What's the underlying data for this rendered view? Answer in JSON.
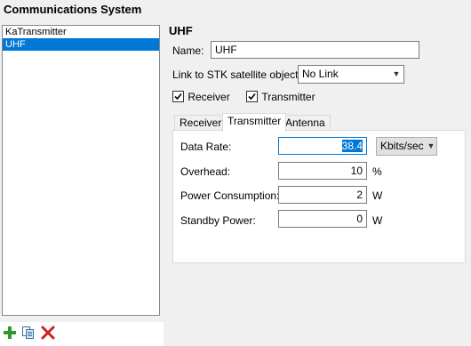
{
  "section_title": "Communications System",
  "systems": [
    {
      "label": "KaTransmitter",
      "selected": false
    },
    {
      "label": "UHF",
      "selected": true
    }
  ],
  "toolbar": {
    "add_icon": "plus-icon",
    "copy_icon": "copy-icon",
    "delete_icon": "delete-x-icon"
  },
  "panel": {
    "title": "UHF",
    "name_label": "Name:",
    "name_value": "UHF",
    "link_label": "Link to STK satellite object:",
    "link_value": "No Link",
    "receiver_label": "Receiver",
    "receiver_checked": true,
    "transmitter_label": "Transmitter",
    "transmitter_checked": true
  },
  "tabs": [
    {
      "label": "Receiver",
      "active": false
    },
    {
      "label": "Transmitter",
      "active": true
    },
    {
      "label": "Antenna",
      "active": false
    }
  ],
  "transmitter": {
    "data_rate_label": "Data Rate:",
    "data_rate_value": "38.4",
    "data_rate_unit": "Kbits/sec",
    "overhead_label": "Overhead:",
    "overhead_value": "10",
    "overhead_unit": "%",
    "power_label": "Power Consumption:",
    "power_value": "2",
    "power_unit": "W",
    "standby_label": "Standby Power:",
    "standby_value": "0",
    "standby_unit": "W"
  },
  "colors": {
    "accent": "#0078d7",
    "add_green": "#2e9a2e",
    "delete_red": "#cc2222"
  }
}
